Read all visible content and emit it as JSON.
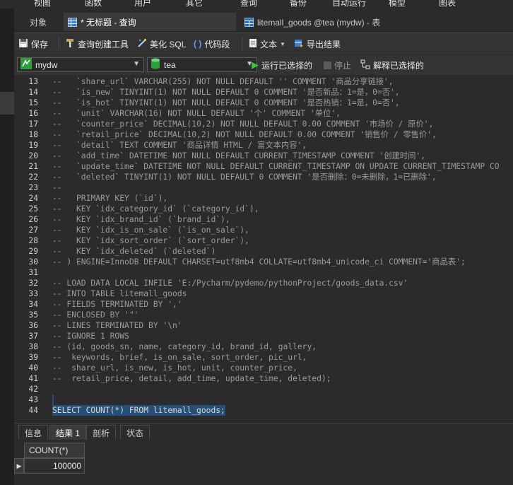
{
  "menu": [
    "视图",
    "函数",
    "用户",
    "其它",
    "查询",
    "备份",
    "自动运行",
    "模型",
    "图表"
  ],
  "tabs": [
    {
      "label": "对象"
    },
    {
      "label": "* 无标题 - 查询"
    },
    {
      "label": "litemall_goods @tea (mydw) - 表"
    }
  ],
  "toolbar": {
    "save": "保存",
    "query_builder": "查询创建工具",
    "beautify": "美化 SQL",
    "snippet": "代码段",
    "text": "文本",
    "export": "导出结果"
  },
  "selectors": {
    "connection": "mydw",
    "database": "tea",
    "run_selected": "运行已选择的",
    "stop": "停止",
    "explain": "解释已选择的"
  },
  "editor": {
    "lines": [
      {
        "n": "13",
        "t": "--   `share_url` VARCHAR(255) NOT NULL DEFAULT '' COMMENT '商品分享链接',"
      },
      {
        "n": "14",
        "t": "--   `is_new` TINYINT(1) NOT NULL DEFAULT 0 COMMENT '是否新品：1=是，0=否',"
      },
      {
        "n": "15",
        "t": "--   `is_hot` TINYINT(1) NOT NULL DEFAULT 0 COMMENT '是否热销：1=是，0=否',"
      },
      {
        "n": "16",
        "t": "--   `unit` VARCHAR(16) NOT NULL DEFAULT '个' COMMENT '单位',"
      },
      {
        "n": "17",
        "t": "--   `counter_price` DECIMAL(10,2) NOT NULL DEFAULT 0.00 COMMENT '市场价 / 原价',"
      },
      {
        "n": "18",
        "t": "--   `retail_price` DECIMAL(10,2) NOT NULL DEFAULT 0.00 COMMENT '销售价 / 零售价',"
      },
      {
        "n": "19",
        "t": "--   `detail` TEXT COMMENT '商品详情 HTML / 富文本内容',"
      },
      {
        "n": "20",
        "t": "--   `add_time` DATETIME NOT NULL DEFAULT CURRENT_TIMESTAMP COMMENT '创建时间',"
      },
      {
        "n": "21",
        "t": "--   `update_time` DATETIME NOT NULL DEFAULT CURRENT_TIMESTAMP ON UPDATE CURRENT_TIMESTAMP CO"
      },
      {
        "n": "22",
        "t": "--   `deleted` TINYINT(1) NOT NULL DEFAULT 0 COMMENT '是否删除：0=未删除，1=已删除',"
      },
      {
        "n": "23",
        "t": "--"
      },
      {
        "n": "24",
        "t": "--   PRIMARY KEY (`id`),"
      },
      {
        "n": "25",
        "t": "--   KEY `idx_category_id` (`category_id`),"
      },
      {
        "n": "26",
        "t": "--   KEY `idx_brand_id` (`brand_id`),"
      },
      {
        "n": "27",
        "t": "--   KEY `idx_is_on_sale` (`is_on_sale`),"
      },
      {
        "n": "28",
        "t": "--   KEY `idx_sort_order` (`sort_order`),"
      },
      {
        "n": "29",
        "t": "--   KEY `idx_deleted` (`deleted`)"
      },
      {
        "n": "30",
        "t": "-- ) ENGINE=InnoDB DEFAULT CHARSET=utf8mb4 COLLATE=utf8mb4_unicode_ci COMMENT='商品表';"
      },
      {
        "n": "31",
        "t": ""
      },
      {
        "n": "32",
        "t": "-- LOAD DATA LOCAL INFILE 'E:/Pycharm/pydemo/pythonProject/goods_data.csv'"
      },
      {
        "n": "33",
        "t": "-- INTO TABLE litemall_goods"
      },
      {
        "n": "34",
        "t": "-- FIELDS TERMINATED BY ','"
      },
      {
        "n": "35",
        "t": "-- ENCLOSED BY '\"'"
      },
      {
        "n": "36",
        "t": "-- LINES TERMINATED BY '\\n'"
      },
      {
        "n": "37",
        "t": "-- IGNORE 1 ROWS"
      },
      {
        "n": "38",
        "t": "-- (id, goods_sn, name, category_id, brand_id, gallery,"
      },
      {
        "n": "39",
        "t": "--  keywords, brief, is_on_sale, sort_order, pic_url,"
      },
      {
        "n": "40",
        "t": "--  share_url, is_new, is_hot, unit, counter_price,"
      },
      {
        "n": "41",
        "t": "--  retail_price, detail, add_time, update_time, deleted);"
      },
      {
        "n": "42",
        "t": ""
      },
      {
        "n": "43",
        "t": ""
      },
      {
        "n": "44",
        "t": "SELECT COUNT(*) FROM litemall_goods;"
      }
    ]
  },
  "bottom_tabs": [
    "信息",
    "结果 1",
    "剖析",
    "状态"
  ],
  "result": {
    "column": "COUNT(*)",
    "row_marker": "▶",
    "value": "100000"
  }
}
